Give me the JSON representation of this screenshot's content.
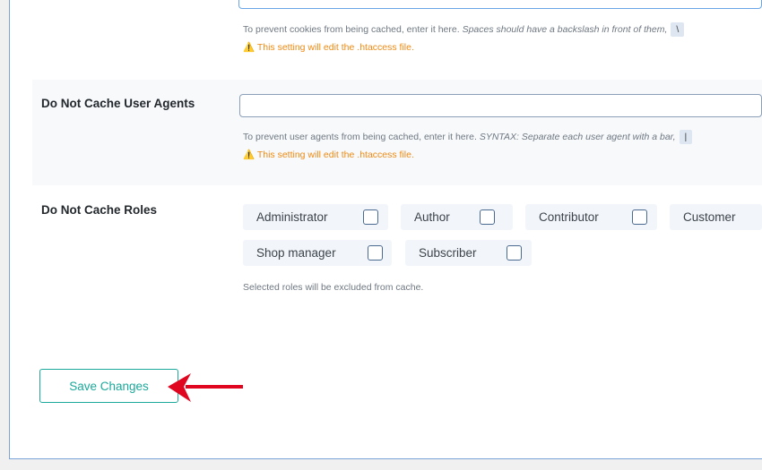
{
  "cookies": {
    "description": "To prevent cookies from being cached, enter it here.",
    "description_italic": "Spaces should have a backslash in front of them,",
    "code": "\\",
    "warning": "This setting will edit the .htaccess file."
  },
  "user_agents": {
    "label": "Do Not Cache User Agents",
    "value": "",
    "description": "To prevent user agents from being cached, enter it here.",
    "description_italic": "SYNTAX: Separate each user agent with a bar,",
    "code": "|",
    "warning": "This setting will edit the .htaccess file."
  },
  "roles": {
    "label": "Do Not Cache Roles",
    "items": [
      {
        "label": "Administrator",
        "checked": false
      },
      {
        "label": "Author",
        "checked": false
      },
      {
        "label": "Contributor",
        "checked": false
      },
      {
        "label": "Customer",
        "checked": false
      },
      {
        "label": "Shop manager",
        "checked": false
      },
      {
        "label": "Subscriber",
        "checked": false
      }
    ],
    "note": "Selected roles will be excluded from cache."
  },
  "save_label": "Save Changes",
  "colors": {
    "accent": "#1aa99a",
    "warning": "#f08a13",
    "arrow": "#e0061f"
  },
  "icons": {
    "warning": "warning-triangle-icon",
    "annotation": "arrow-left-icon"
  }
}
